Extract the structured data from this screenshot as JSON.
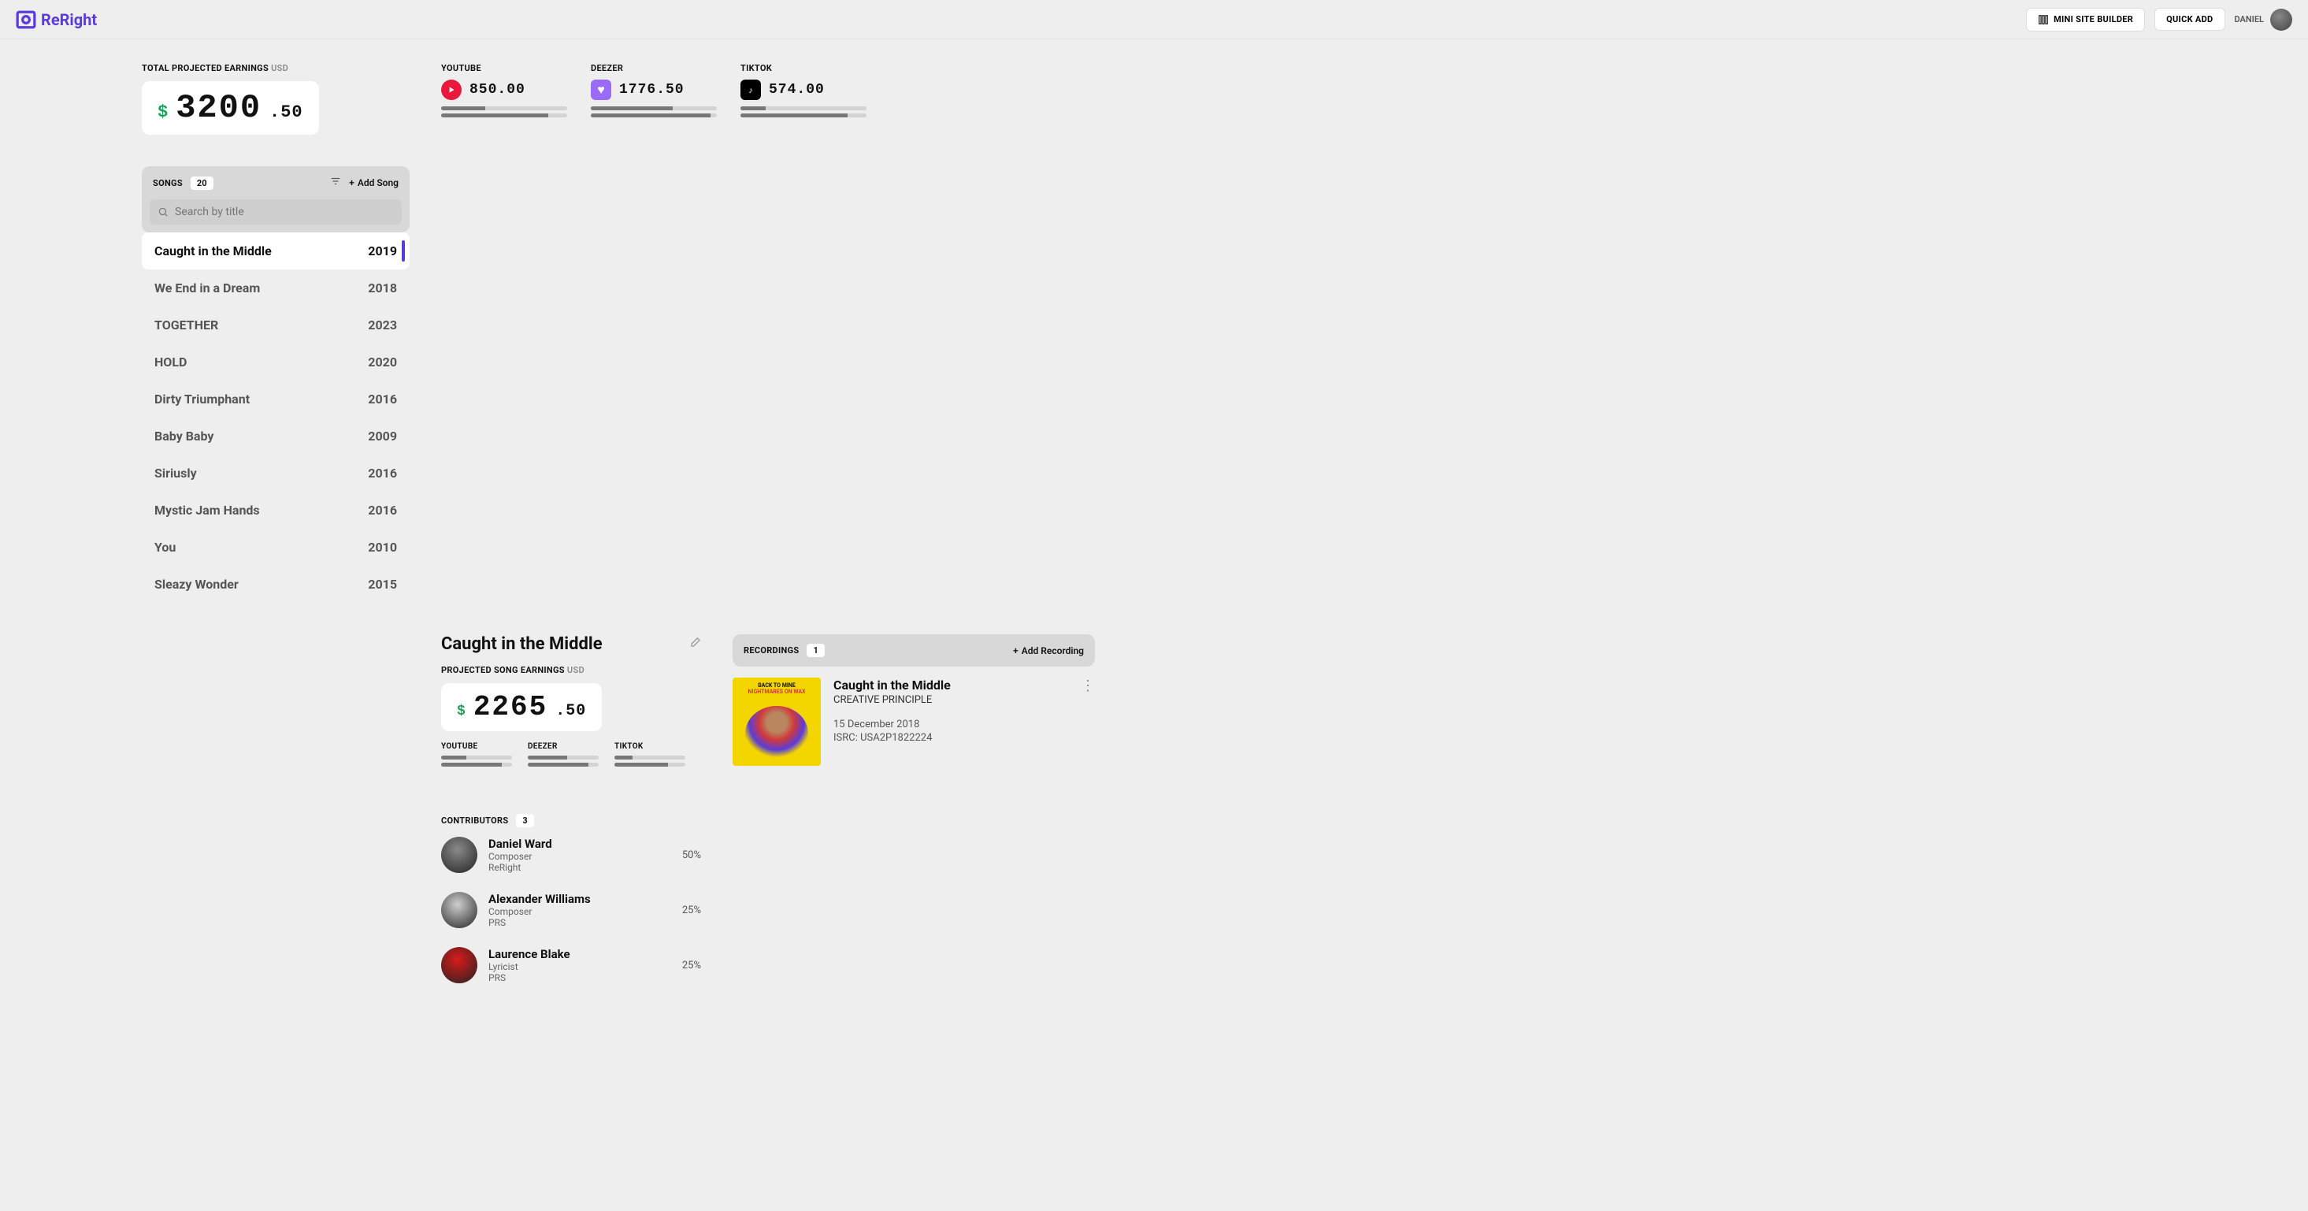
{
  "header": {
    "brand": "ReRight",
    "miniSite": "MINI SITE BUILDER",
    "quickAdd": "QUICK ADD",
    "user": "DANIEL"
  },
  "totalEarnings": {
    "label": "TOTAL PROJECTED EARNINGS",
    "currency": "USD",
    "whole": "3200",
    "decimal": ".50"
  },
  "platforms": [
    {
      "name": "YOUTUBE",
      "value": "850.00",
      "color": "#e8193c",
      "bars": [
        35,
        85
      ]
    },
    {
      "name": "DEEZER",
      "value": "1776.50",
      "color": "#9b6af7",
      "bars": [
        65,
        95
      ]
    },
    {
      "name": "TIKTOK",
      "value": "574.00",
      "color": "#000000",
      "bars": [
        20,
        85
      ]
    }
  ],
  "songsPanel": {
    "label": "SONGS",
    "count": "20",
    "addLabel": "Add Song",
    "searchPlaceholder": "Search by title"
  },
  "songs": [
    {
      "title": "Caught in the Middle",
      "year": "2019",
      "active": true
    },
    {
      "title": "We End in a Dream",
      "year": "2018"
    },
    {
      "title": "TOGETHER",
      "year": "2023"
    },
    {
      "title": "HOLD",
      "year": "2020"
    },
    {
      "title": "Dirty Triumphant",
      "year": "2016"
    },
    {
      "title": "Baby Baby",
      "year": "2009"
    },
    {
      "title": "Siriusly",
      "year": "2016"
    },
    {
      "title": "Mystic Jam Hands",
      "year": "2016"
    },
    {
      "title": "You",
      "year": "2010"
    },
    {
      "title": "Sleazy Wonder",
      "year": "2015"
    }
  ],
  "selectedSong": {
    "title": "Caught in the Middle",
    "earningsLabel": "PROJECTED SONG EARNINGS",
    "currency": "USD",
    "whole": "2265",
    "decimal": ".50",
    "platforms": [
      {
        "name": "YOUTUBE",
        "bars": [
          35,
          85
        ]
      },
      {
        "name": "DEEZER",
        "bars": [
          55,
          85
        ]
      },
      {
        "name": "TIKTOK",
        "bars": [
          25,
          75
        ]
      }
    ]
  },
  "contributors": {
    "label": "CONTRIBUTORS",
    "count": "3",
    "list": [
      {
        "name": "Daniel Ward",
        "role": "Composer",
        "org": "ReRight",
        "share": "50%",
        "avColor": "#8a8a8a"
      },
      {
        "name": "Alexander Williams",
        "role": "Composer",
        "org": "PRS",
        "share": "25%",
        "avColor": "#cfcfcf"
      },
      {
        "name": "Laurence Blake",
        "role": "Lyricist",
        "org": "PRS",
        "share": "25%",
        "avColor": "#d91b1b"
      }
    ]
  },
  "recordings": {
    "label": "RECORDINGS",
    "count": "1",
    "addLabel": "Add Recording",
    "item": {
      "title": "Caught in the Middle",
      "artist": "CREATIVE PRINCIPLE",
      "date": "15 December 2018",
      "isrc": "ISRC: USA2P1822224",
      "artLine1": "BACK TO MINE",
      "artLine2": "NIGHTMARES ON WAX"
    }
  }
}
